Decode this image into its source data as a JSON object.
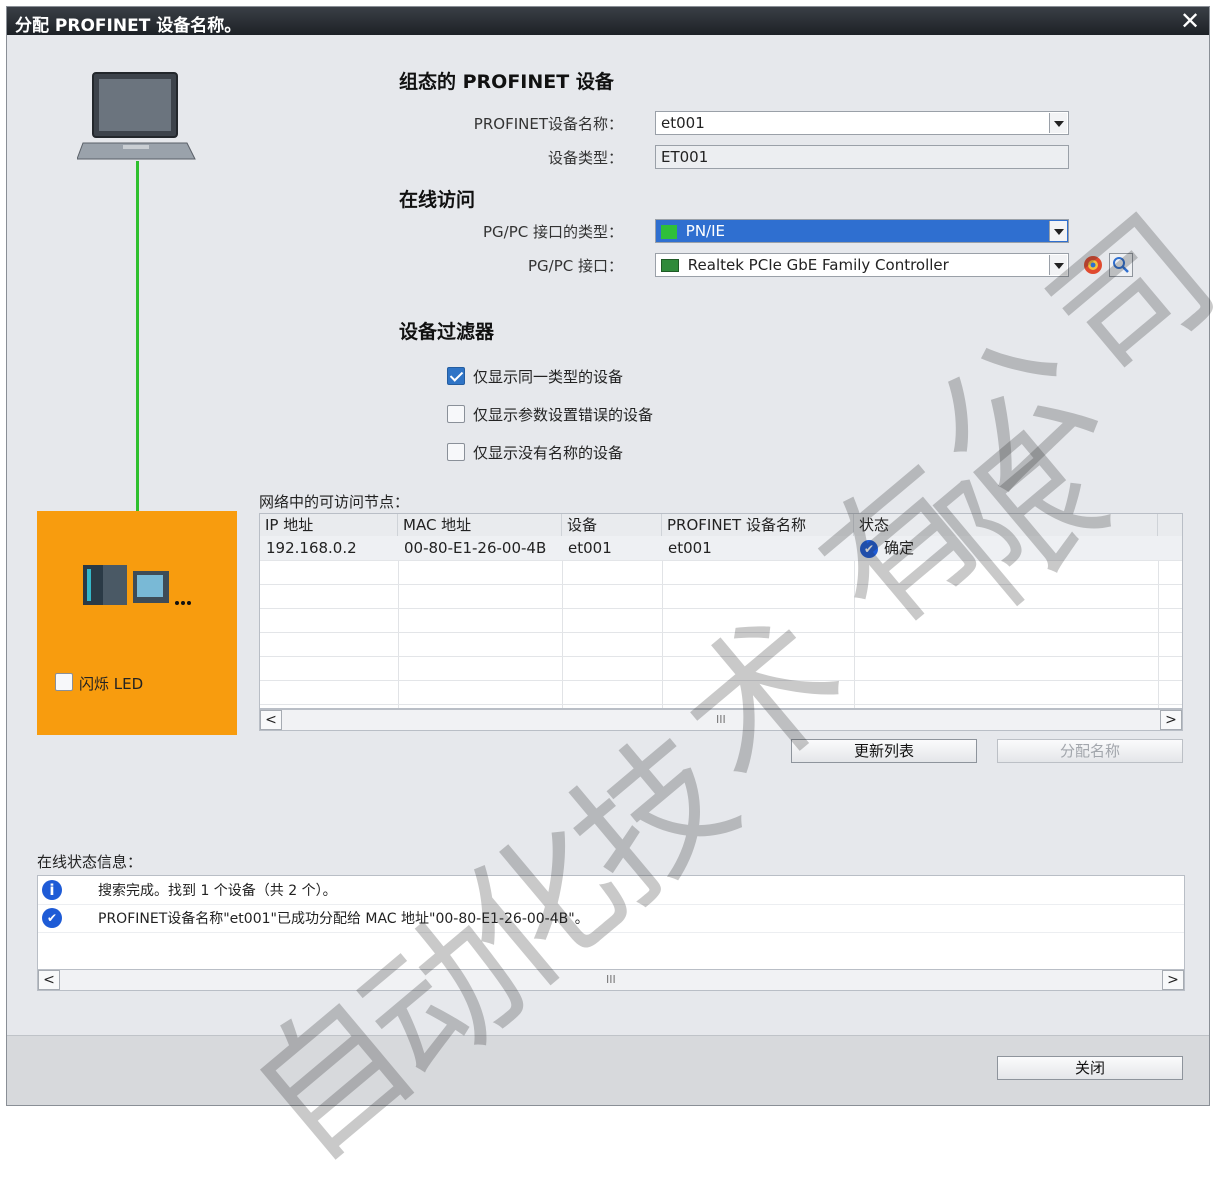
{
  "window": {
    "title": "分配 PROFINET 设备名称。",
    "close_glyph": "✕"
  },
  "configured": {
    "heading": "组态的 PROFINET 设备",
    "device_name_label": "PROFINET设备名称：",
    "device_name_value": "et001",
    "device_type_label": "设备类型：",
    "device_type_value": "ET001"
  },
  "online": {
    "heading": "在线访问",
    "iface_type_label": "PG/PC 接口的类型：",
    "iface_type_value": "PN/IE",
    "iface_label": "PG/PC 接口：",
    "iface_value": "Realtek PCIe GbE Family Controller"
  },
  "filter": {
    "heading": "设备过滤器",
    "options": [
      {
        "label": "仅显示同一类型的设备",
        "checked": true
      },
      {
        "label": "仅显示参数设置错误的设备",
        "checked": false
      },
      {
        "label": "仅显示没有名称的设备",
        "checked": false
      }
    ]
  },
  "nodes": {
    "heading": "网络中的可访问节点：",
    "columns": [
      "IP 地址",
      "MAC 地址",
      "设备",
      "PROFINET 设备名称",
      "状态"
    ],
    "rows": [
      {
        "ip": "192.168.0.2",
        "mac": "00-80-E1-26-00-4B",
        "device": "et001",
        "pn_name": "et001",
        "status": "确定"
      }
    ],
    "scroll_grip": "III"
  },
  "buttons": {
    "update_list": "更新列表",
    "assign_name": "分配名称",
    "close": "关闭"
  },
  "led": {
    "label": "闪烁 LED",
    "checked": false
  },
  "status": {
    "heading": "在线状态信息：",
    "messages": [
      {
        "icon": "info-icon",
        "text": "搜索完成。找到 1 个设备（共 2 个）。"
      },
      {
        "icon": "ok-icon",
        "text": "PROFINET设备名称\"et001\"已成功分配给 MAC 地址\"00-80-E1-26-00-4B\"。"
      }
    ],
    "scroll_grip": "III"
  },
  "watermark": [
    "公",
    "司",
    "有",
    "限",
    "技",
    "术",
    "化",
    "动",
    "自"
  ],
  "colors": {
    "accent_orange": "#f89c0e",
    "link_line": "#2ec02e",
    "selected_blue": "#2f6fd0"
  }
}
